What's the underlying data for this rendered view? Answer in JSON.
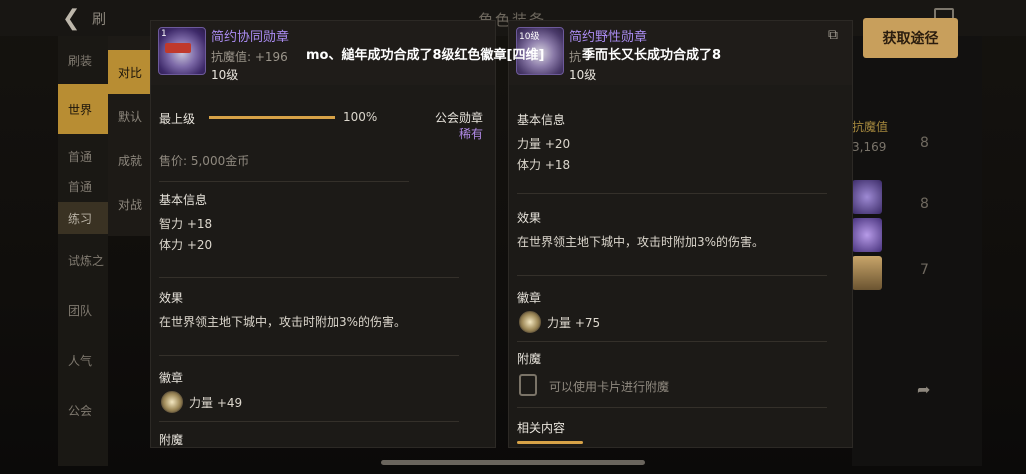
{
  "background": {
    "title": "角色装备",
    "back_text": "刷",
    "left_list": [
      "刷装",
      "世界",
      "首通",
      "首通",
      "练习",
      "试炼之",
      "团队",
      "人气",
      "公会"
    ],
    "filters": [
      "对比",
      "默认",
      "成就",
      "对战"
    ],
    "side_label": "抗魔值",
    "side_value": "3,169",
    "side_numbers": [
      "8",
      "8",
      "7"
    ]
  },
  "left_panel": {
    "item_name": "简约协同勋章",
    "icon_level": "1",
    "attr": "抗魔值: +196",
    "level": "10级",
    "max_level_label": "最上级",
    "progress_fraction": 1.0,
    "progress_text": "100%",
    "guild_badge_label": "公会勋章",
    "rarity": "稀有",
    "price": "售价: 5,000金币",
    "basic_info_title": "基本信息",
    "basic_stats": [
      "智力 +18",
      "体力 +20"
    ],
    "effect_title": "效果",
    "effect_text": "在世界领主地下城中，攻击时附加3%的伤害。",
    "emblem_title": "徽章",
    "emblem_stat": "力量 +49",
    "enchant_title": "附魔"
  },
  "right_panel": {
    "item_name": "简约野性勋章",
    "icon_level": "10级",
    "attr": "抗",
    "level": "10级",
    "basic_info_title": "基本信息",
    "basic_stats": [
      "力量 +20",
      "体力 +18"
    ],
    "effect_title": "效果",
    "effect_text": "在世界领主地下城中，攻击时附加3%的伤害。",
    "emblem_title": "徽章",
    "emblem_stat": "力量 +75",
    "enchant_title": "附魔",
    "enchant_hint": "可以使用卡片进行附魔",
    "related_title": "相关内容"
  },
  "get_button": "获取途径",
  "chat": {
    "msg1": "mo、縋年成功合成了8级红色徽章[四维]",
    "msg2": "季而长又长成功合成了8"
  },
  "icons": {
    "back": "back-arrow-icon",
    "edit": "edit-icon",
    "share": "share-icon"
  },
  "colors": {
    "accent": "#b88d33",
    "purple_name": "#a98bf0",
    "rarity": "#b18ae6",
    "button": "#c89f5c"
  }
}
